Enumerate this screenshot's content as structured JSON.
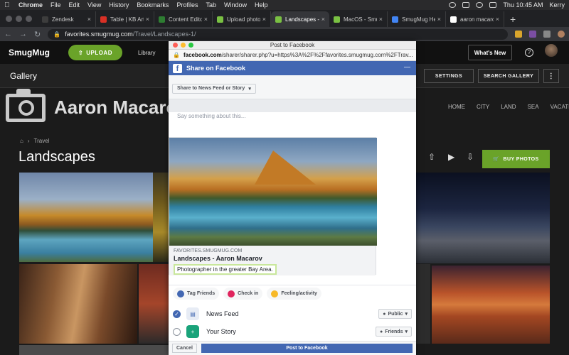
{
  "menubar": {
    "app": "Chrome",
    "items": [
      "File",
      "Edit",
      "View",
      "History",
      "Bookmarks",
      "Profiles",
      "Tab",
      "Window",
      "Help"
    ],
    "clock": "Thu 10:45 AM",
    "user": "Kerry"
  },
  "tabs": [
    {
      "label": "Zendesk",
      "color": "#3d3d3d"
    },
    {
      "label": "Table | KB Artic",
      "color": "#d93025"
    },
    {
      "label": "Content Editor",
      "color": "#2e7d32"
    },
    {
      "label": "Upload photos",
      "color": "#7ac143"
    },
    {
      "label": "Landscapes - A",
      "color": "#7ac143",
      "active": true
    },
    {
      "label": "MacOS - Smug",
      "color": "#7ac143"
    },
    {
      "label": "SmugMug Help",
      "color": "#4285f4"
    },
    {
      "label": "aaron macarov",
      "color": "#ffffff"
    }
  ],
  "address": {
    "host": "favorites.smugmug.com",
    "path": "/Travel/Landscapes-1/"
  },
  "smugmug": {
    "logo_text": "SmugMug",
    "upload_label": "UPLOAD",
    "nav_library": "Library",
    "whats_new": "What's New",
    "help": "?"
  },
  "gallery": {
    "title": "Gallery",
    "settings": "SETTINGS",
    "search": "SEARCH GALLERY"
  },
  "site": {
    "name": "Aaron Macaro",
    "nav": [
      "HOME",
      "CITY",
      "LAND",
      "SEA",
      "VACATION"
    ],
    "breadcrumb": "Travel",
    "page_title": "Landscapes",
    "buy_photos": "BUY PHOTOS"
  },
  "facebook": {
    "window_title": "Post to Facebook",
    "url_host": "facebook.com",
    "url_rest": "/sharer/sharer.php?u=https%3A%2F%2Ffavorites.smugmug.com%2FTrav...",
    "header": "Share on Facebook",
    "share_target": "Share to News Feed or Story",
    "placeholder": "Say something about this...",
    "link_domain": "FAVORITES.SMUGMUG.COM",
    "link_title": "Landscapes - Aaron Macarov",
    "link_description": "Photographer in the greater Bay Area.",
    "actions": {
      "tag_friends": "Tag Friends",
      "check_in": "Check in",
      "feeling": "Feeling/activity"
    },
    "destinations": [
      {
        "label": "News Feed",
        "audience": "Public",
        "checked": true
      },
      {
        "label": "Your Story",
        "audience": "Friends",
        "checked": false
      }
    ],
    "cancel": "Cancel",
    "post": "Post to Facebook"
  },
  "colors": {
    "facebook_blue": "#4267b2",
    "smugmug_green": "#6aa329"
  }
}
